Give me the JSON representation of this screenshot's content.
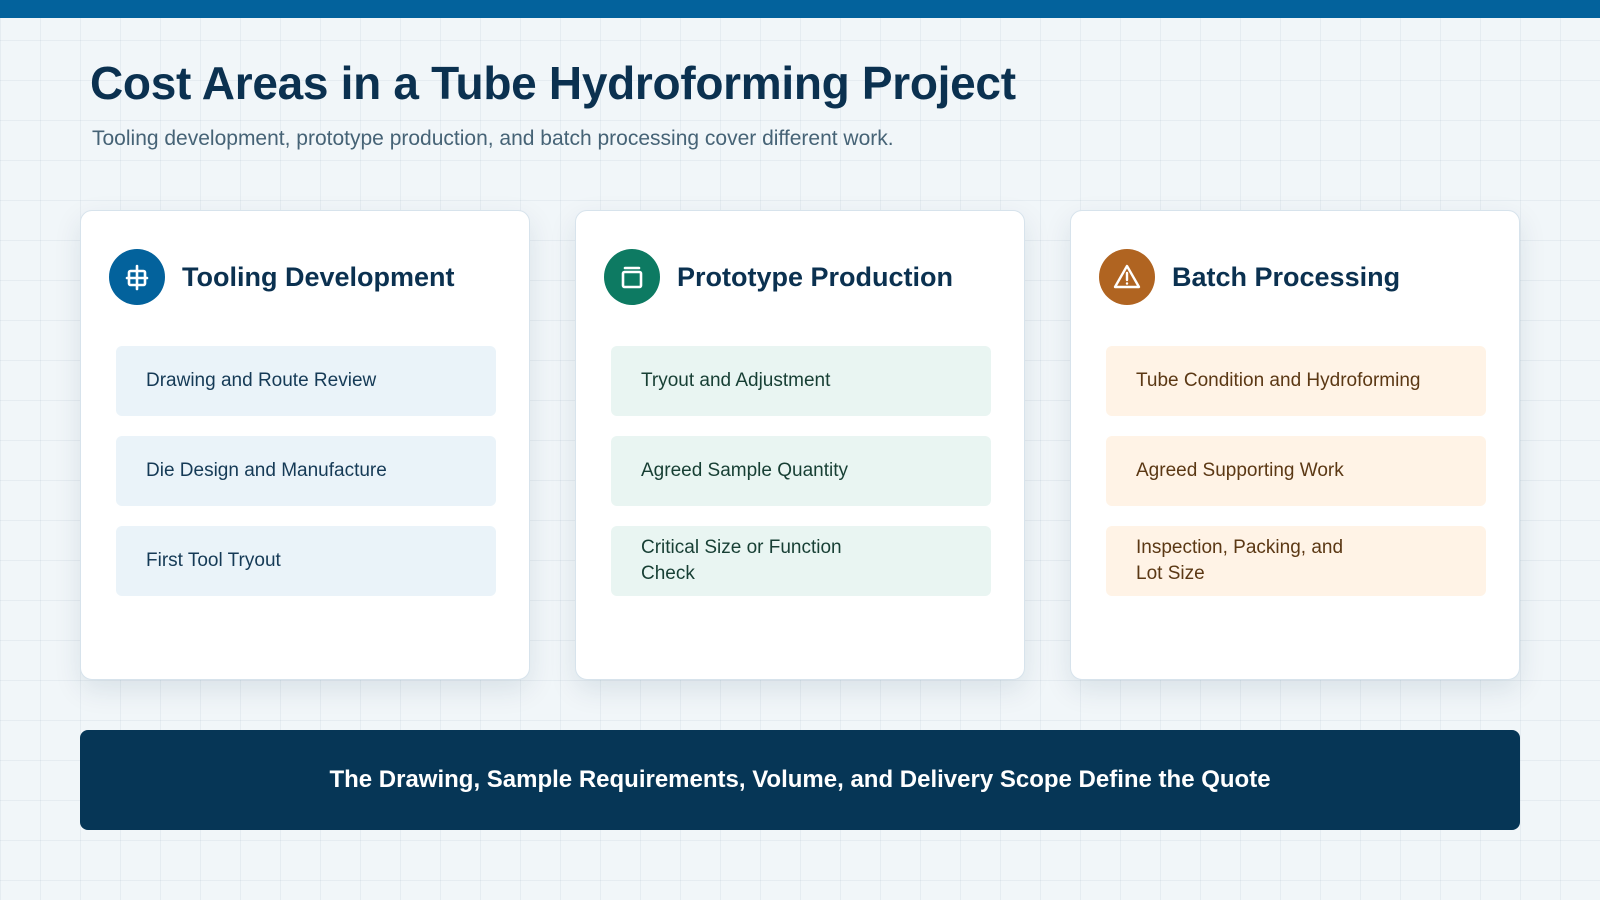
{
  "header": {
    "title": "Cost Areas in a Tube Hydroforming Project",
    "subtitle": "Tooling development, prototype production, and batch processing cover different work."
  },
  "colors": {
    "accent_blue": "#03629c",
    "accent_green": "#0d7a62",
    "accent_orange": "#b06421",
    "banner": "#063656"
  },
  "cards": [
    {
      "title": "Tooling Development",
      "icon": "die-frame-icon",
      "items": [
        "Drawing and Route Review",
        "Die Design and Manufacture",
        "First Tool Tryout"
      ]
    },
    {
      "title": "Prototype Production",
      "icon": "sample-box-icon",
      "items": [
        "Tryout and Adjustment",
        "Agreed Sample Quantity",
        "Critical Size or Function Check"
      ]
    },
    {
      "title": "Batch Processing",
      "icon": "warning-triangle-icon",
      "items": [
        "Tube Condition and Hydroforming",
        "Agreed Supporting Work",
        "Inspection, Packing, and Lot Size"
      ]
    }
  ],
  "footer": {
    "text": "The Drawing, Sample Requirements, Volume, and Delivery Scope Define the Quote"
  }
}
